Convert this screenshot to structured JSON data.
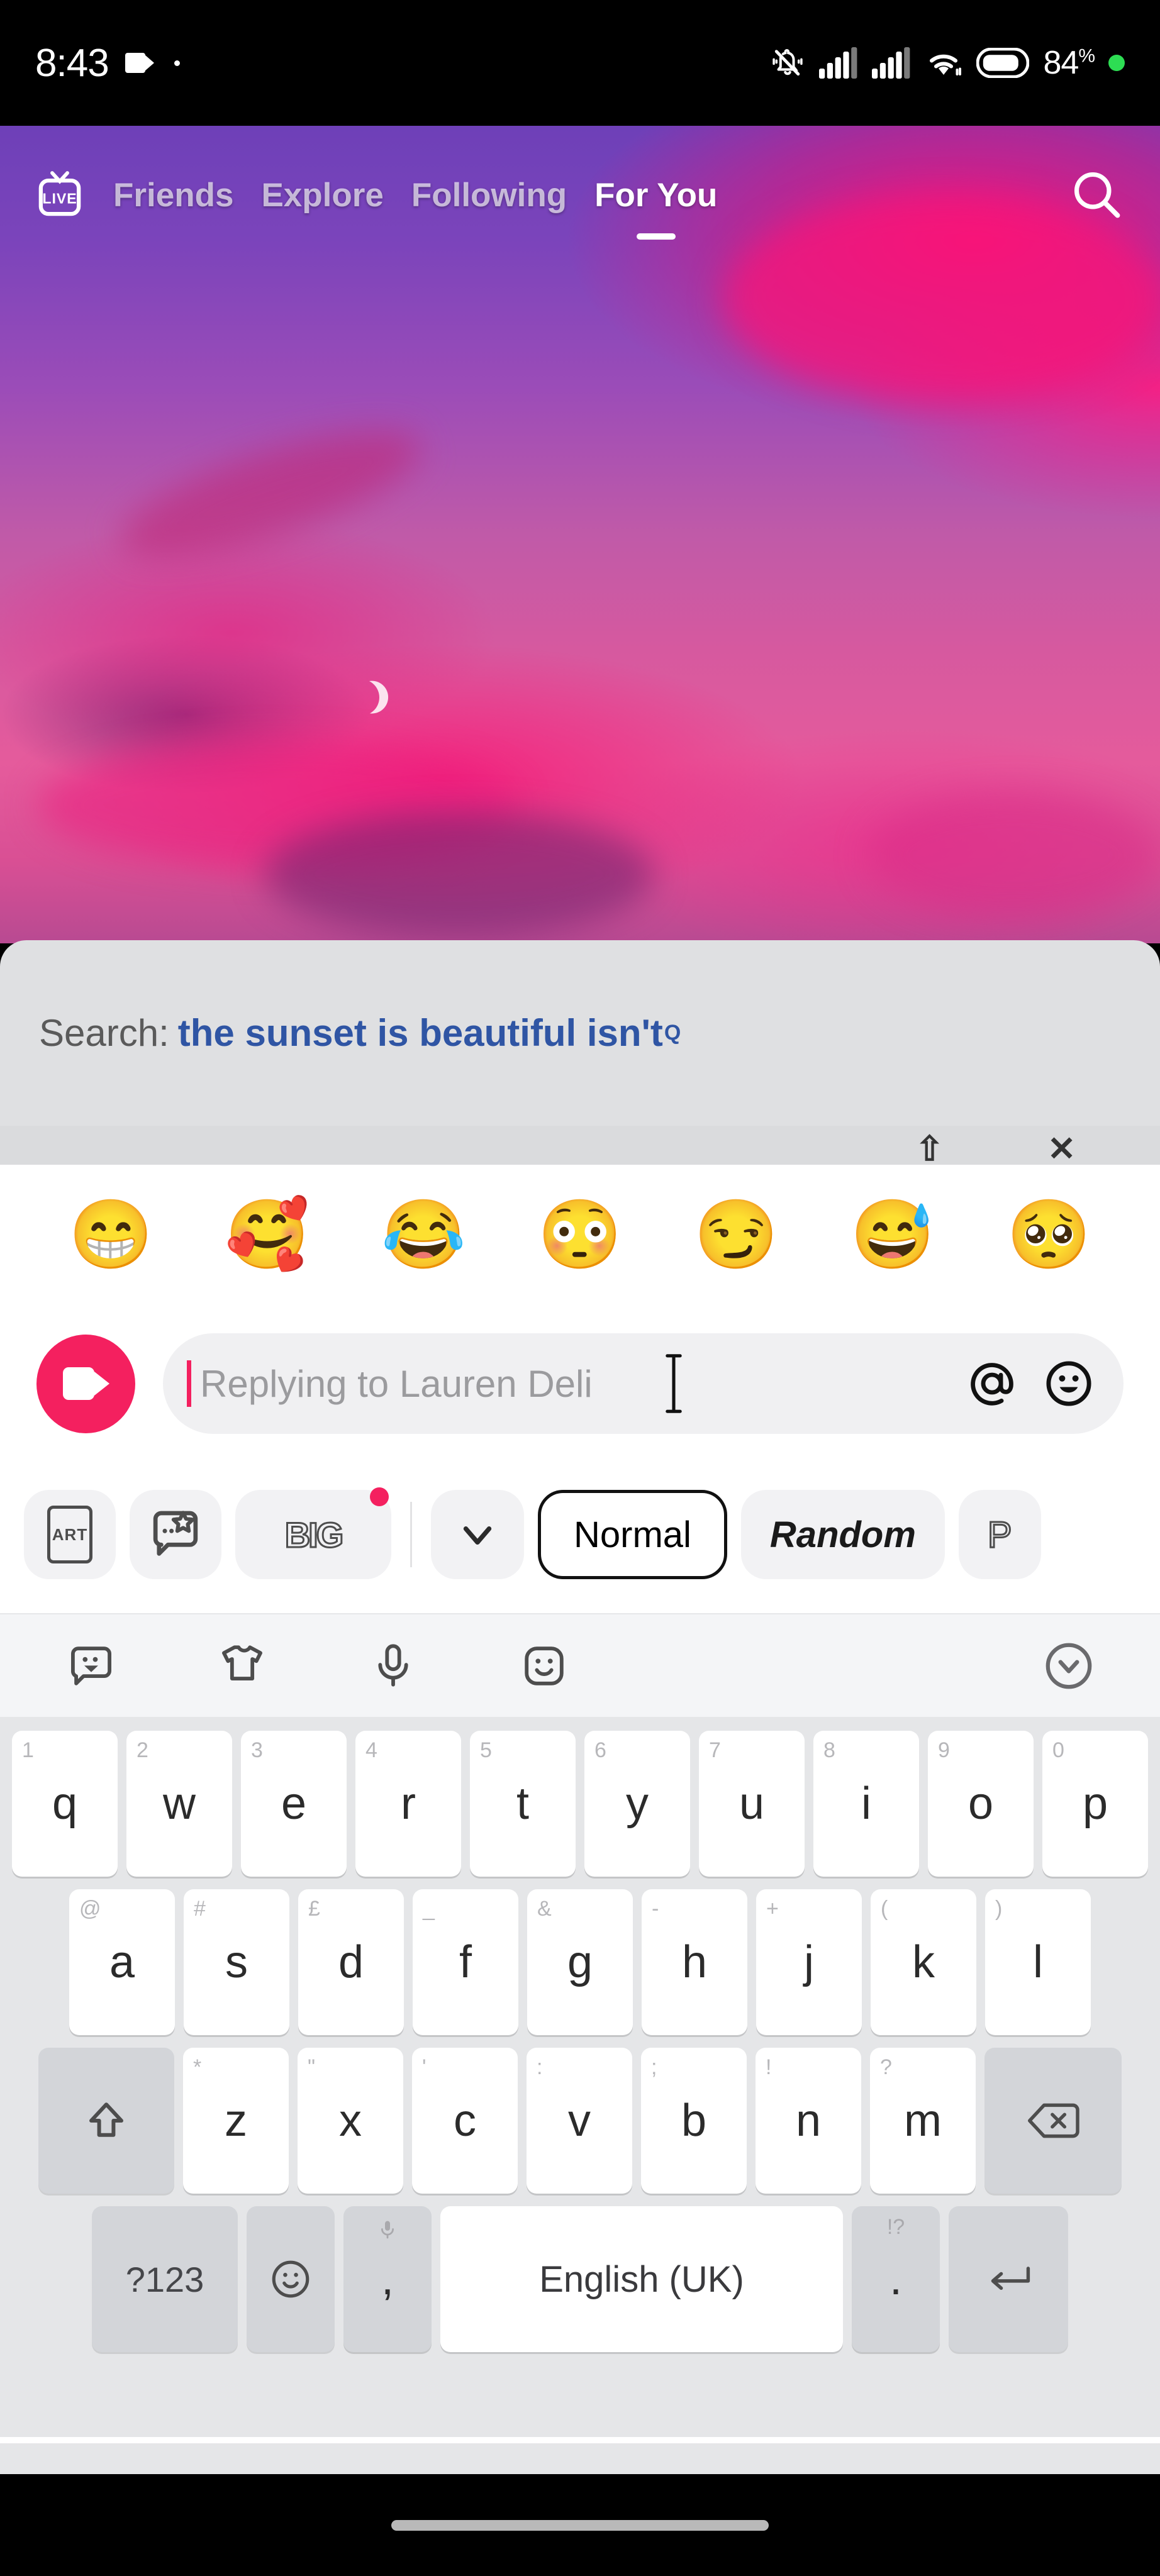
{
  "status_bar": {
    "time": "8:43",
    "battery_percent": "84",
    "percent_symbol": "%",
    "icons": [
      "video-recording-icon",
      "recording-dot-icon",
      "silent-bell-icon",
      "signal-sim1-icon",
      "signal-sim2-icon",
      "wifi-icon",
      "battery-icon",
      "green-status-dot"
    ]
  },
  "top_nav": {
    "live_label": "LIVE",
    "tabs": [
      {
        "label": "Friends",
        "active": false
      },
      {
        "label": "Explore",
        "active": false
      },
      {
        "label": "Following",
        "active": false
      },
      {
        "label": "For You",
        "active": true
      }
    ],
    "search_icon": "search-icon"
  },
  "video": {
    "description": "sunset sky with pink and purple clouds and crescent moon"
  },
  "search_suggestion": {
    "label": "Search:",
    "query": "the sunset is beautiful isn't",
    "superscript": "Q",
    "accent_color": "#2f55a4",
    "panel_color": "#dfe0e2"
  },
  "emoji_row": {
    "emojis": [
      "😁",
      "🥰",
      "😂",
      "😳",
      "😏",
      "😅",
      "🥺"
    ]
  },
  "reply_bar": {
    "camera_button": "video-comment-button",
    "camera_color": "#f4205f",
    "placeholder": "Replying to Lauren Deli",
    "value": "",
    "mention_icon": "at-mention-icon",
    "emoji_icon": "emoji-picker-icon"
  },
  "style_toolbar": {
    "items": [
      {
        "name": "art-button",
        "label": "ART",
        "type": "icon-box"
      },
      {
        "name": "sticker-button",
        "label": "",
        "type": "sticker"
      },
      {
        "name": "big-text-button",
        "label": "BIG",
        "type": "big",
        "badge": true
      },
      {
        "name": "collapse-button",
        "label": "",
        "type": "chevron"
      },
      {
        "name": "style-normal",
        "label": "Normal",
        "selected": true
      },
      {
        "name": "style-random",
        "label": "Random",
        "selected": false
      },
      {
        "name": "style-partial",
        "label": "P",
        "selected": false
      }
    ]
  },
  "keyboard_toolbar": {
    "icons": [
      "sticker-bubble-icon",
      "theme-shirt-icon",
      "microphone-icon",
      "smiley-icon",
      "collapse-chevron-icon"
    ]
  },
  "keyboard": {
    "rows": [
      [
        {
          "main": "q",
          "sec": "1"
        },
        {
          "main": "w",
          "sec": "2"
        },
        {
          "main": "e",
          "sec": "3"
        },
        {
          "main": "r",
          "sec": "4"
        },
        {
          "main": "t",
          "sec": "5"
        },
        {
          "main": "y",
          "sec": "6"
        },
        {
          "main": "u",
          "sec": "7"
        },
        {
          "main": "i",
          "sec": "8"
        },
        {
          "main": "o",
          "sec": "9"
        },
        {
          "main": "p",
          "sec": "0"
        }
      ],
      [
        {
          "main": "a",
          "sec": "@"
        },
        {
          "main": "s",
          "sec": "#"
        },
        {
          "main": "d",
          "sec": "£"
        },
        {
          "main": "f",
          "sec": "_"
        },
        {
          "main": "g",
          "sec": "&"
        },
        {
          "main": "h",
          "sec": "-"
        },
        {
          "main": "j",
          "sec": "+"
        },
        {
          "main": "k",
          "sec": "("
        },
        {
          "main": "l",
          "sec": ")"
        }
      ],
      [
        {
          "main": "z",
          "sec": "*"
        },
        {
          "main": "x",
          "sec": "\""
        },
        {
          "main": "c",
          "sec": "'"
        },
        {
          "main": "v",
          "sec": ":"
        },
        {
          "main": "b",
          "sec": ";"
        },
        {
          "main": "n",
          "sec": "!"
        },
        {
          "main": "m",
          "sec": "?"
        }
      ]
    ],
    "shift_key": "shift-icon",
    "backspace_key": "backspace-icon",
    "symbols_key": "?123",
    "emoji_key": "emoji-key-icon",
    "comma_key": ",",
    "comma_sec": "microphone-icon",
    "space_key": "English (UK)",
    "period_key": ".",
    "period_sec": "!?",
    "enter_key": "enter-icon",
    "hide_keyboard_icon": "chevron-down-icon"
  },
  "nav_bar": {
    "home_indicator": "home-indicator"
  }
}
